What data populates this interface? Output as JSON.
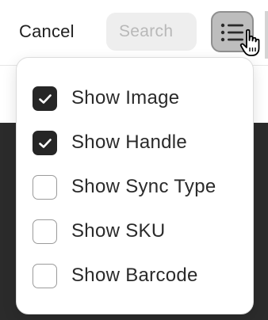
{
  "header": {
    "cancel_label": "Cancel",
    "search_placeholder": "Search",
    "list_toggle_icon": "list-icon"
  },
  "menu": {
    "items": [
      {
        "label": "Show Image",
        "checked": true
      },
      {
        "label": "Show Handle",
        "checked": true
      },
      {
        "label": "Show Sync Type",
        "checked": false
      },
      {
        "label": "Show SKU",
        "checked": false
      },
      {
        "label": "Show Barcode",
        "checked": false
      }
    ]
  },
  "colors": {
    "checkbox_checked": "#262626",
    "toggle_active_bg": "#bdbdbd",
    "backdrop_dark": "#2b2b2b"
  }
}
